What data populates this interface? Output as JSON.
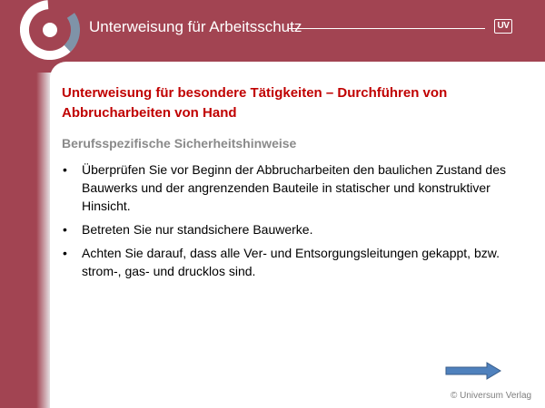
{
  "header": {
    "title": "Unterweisung für Arbeitsschutz",
    "badge": "UV",
    "brand_color": "#a24452"
  },
  "slide": {
    "title": "Unterweisung für besondere Tätigkeiten – Durchführen von Abbrucharbeiten von Hand",
    "subtitle": "Berufsspezifische Sicherheitshinweise",
    "bullet_symbol": "•",
    "bullets": [
      "Überprüfen Sie vor Beginn der Abbrucharbeiten den baulichen Zustand des Bauwerks und der angrenzenden Bauteile in statischer und konstruktiver Hinsicht.",
      "Betreten Sie nur standsichere Bauwerke.",
      "Achten Sie darauf, dass alle Ver- und Entsorgungsleitungen gekappt, bzw. strom-, gas- und drucklos sind."
    ],
    "title_color": "#c00000",
    "subtitle_color": "#8a8a8a"
  },
  "footer": {
    "copyright": "© Universum Verlag",
    "next_icon": "arrow-right-icon",
    "arrow_color": "#4f81bd"
  }
}
